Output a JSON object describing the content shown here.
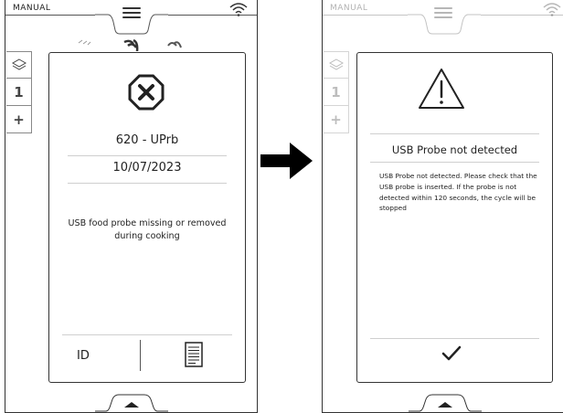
{
  "left_screen": {
    "mode_label": "MANUAL",
    "side_tabs": [
      "1",
      "+"
    ],
    "error_code": "620 - UPrb",
    "error_date": "10/07/2023",
    "error_message": "USB food probe missing or removed during cooking",
    "id_label": "ID"
  },
  "right_screen": {
    "mode_label": "MANUAL",
    "side_tabs": [
      "1",
      "+"
    ],
    "title": "USB Probe not detected",
    "description": "USB Probe not detected. Please check that the USB probe is inserted. If the probe is not detected within 120 seconds, the cycle will be stopped"
  },
  "icons": {
    "menu": "hamburger-menu-icon",
    "wifi": "wifi-icon",
    "layers": "layers-icon",
    "error": "error-octagon-x-icon",
    "document": "document-icon",
    "warning": "warning-triangle-icon",
    "confirm": "checkmark-icon",
    "expand": "chevron-up-icon",
    "transition": "right-arrow-icon"
  },
  "colors": {
    "line": "#333333",
    "background": "#ffffff"
  }
}
